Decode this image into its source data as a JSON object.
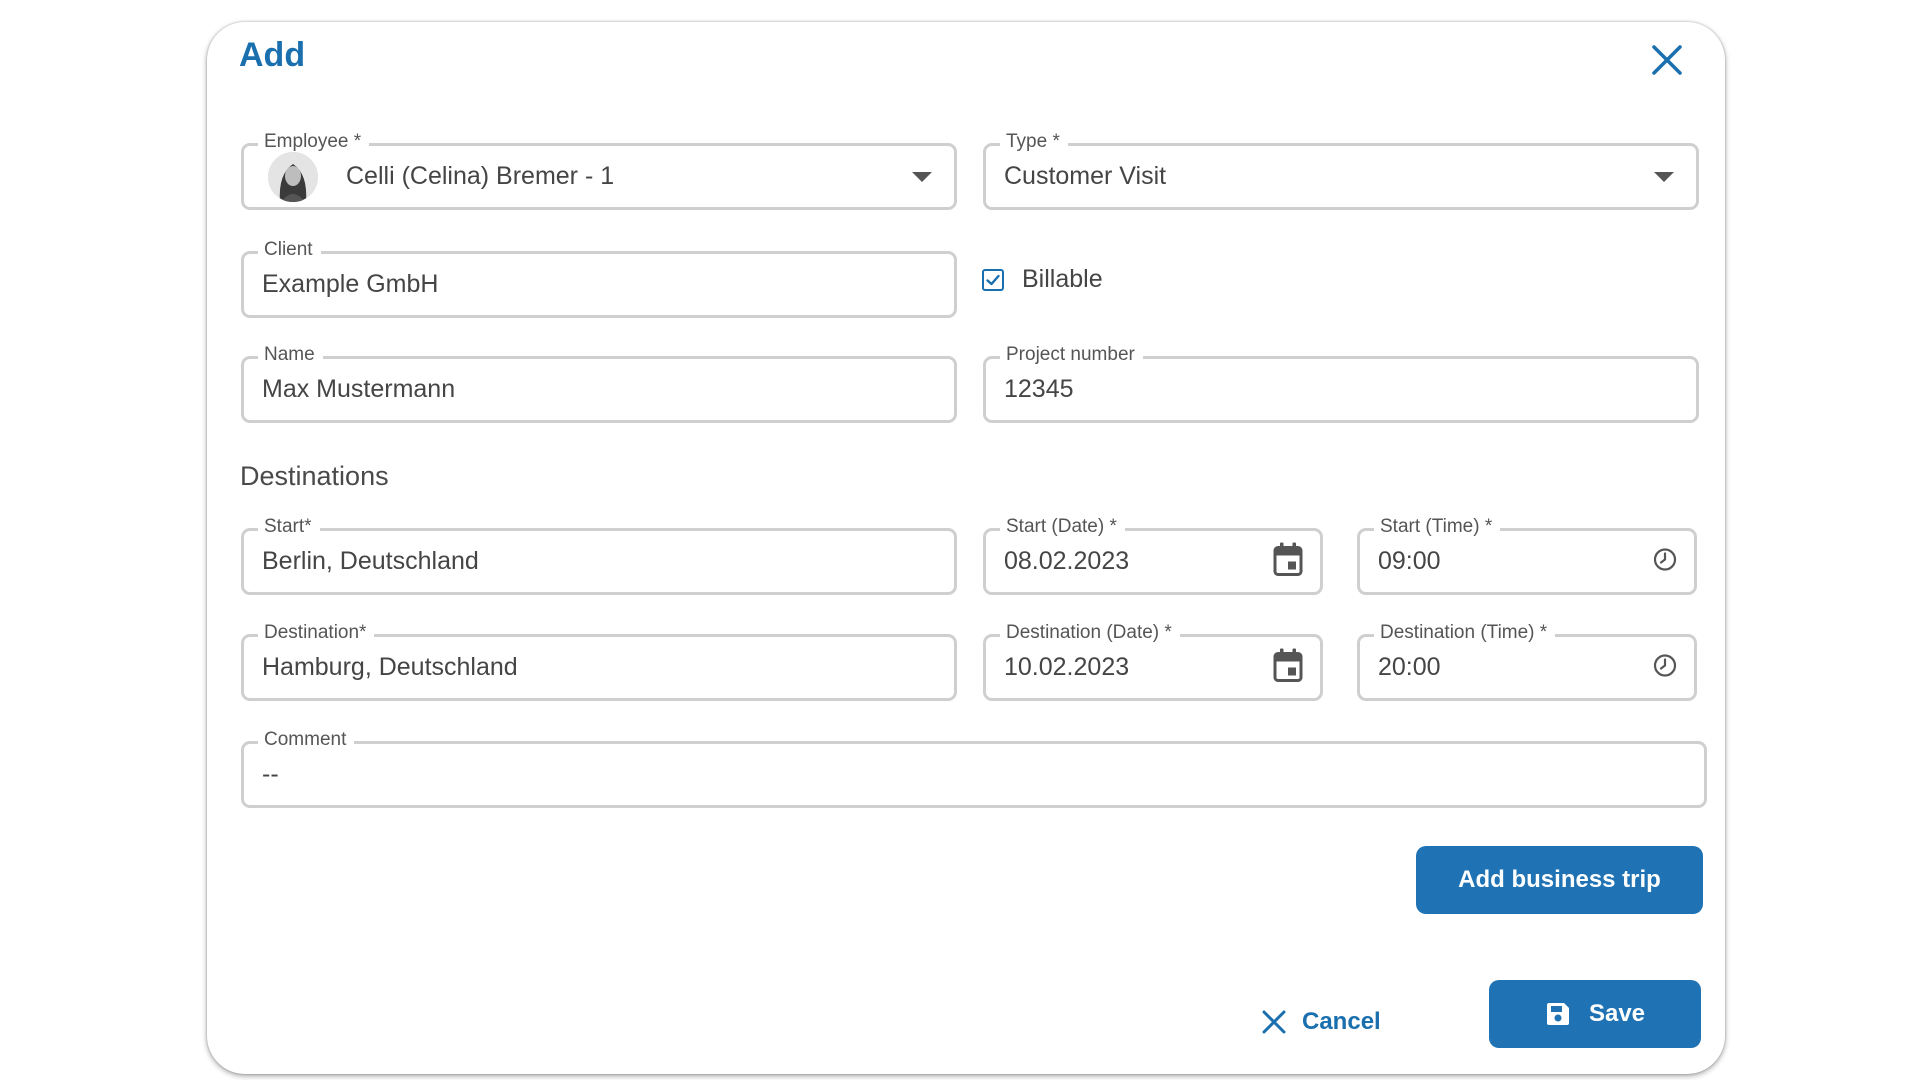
{
  "dialog": {
    "title": "Add"
  },
  "employee": {
    "label": "Employee  *",
    "value": "Celli (Celina) Bremer - 1"
  },
  "type": {
    "label": "Type *",
    "value": "Customer Visit"
  },
  "client": {
    "label": "Client",
    "value": "Example GmbH"
  },
  "billable": {
    "label": "Billable",
    "checked": true
  },
  "name": {
    "label": "Name",
    "value": "Max Mustermann"
  },
  "project_number": {
    "label": "Project number",
    "value": "12345"
  },
  "destinations": {
    "title": "Destinations",
    "start": {
      "label": "Start*",
      "value": "Berlin, Deutschland"
    },
    "start_date": {
      "label": "Start (Date) *",
      "value": "08.02.2023"
    },
    "start_time": {
      "label": "Start (Time) *",
      "value": "09:00"
    },
    "destination": {
      "label": "Destination*",
      "value": "Hamburg, Deutschland"
    },
    "destination_date": {
      "label": "Destination (Date) *",
      "value": "10.02.2023"
    },
    "destination_time": {
      "label": "Destination (Time) *",
      "value": "20:00"
    }
  },
  "comment": {
    "label": "Comment",
    "value": "--"
  },
  "buttons": {
    "add_trip": "Add business trip",
    "cancel": "Cancel",
    "save": "Save"
  },
  "colors": {
    "accent": "#1f72b3",
    "title": "#1a6fae",
    "border": "#cfcfcf"
  },
  "icons": [
    "close-icon",
    "chevron-down-icon",
    "calendar-icon",
    "clock-icon",
    "checkbox-checked-icon",
    "save-icon",
    "cancel-x-icon"
  ]
}
